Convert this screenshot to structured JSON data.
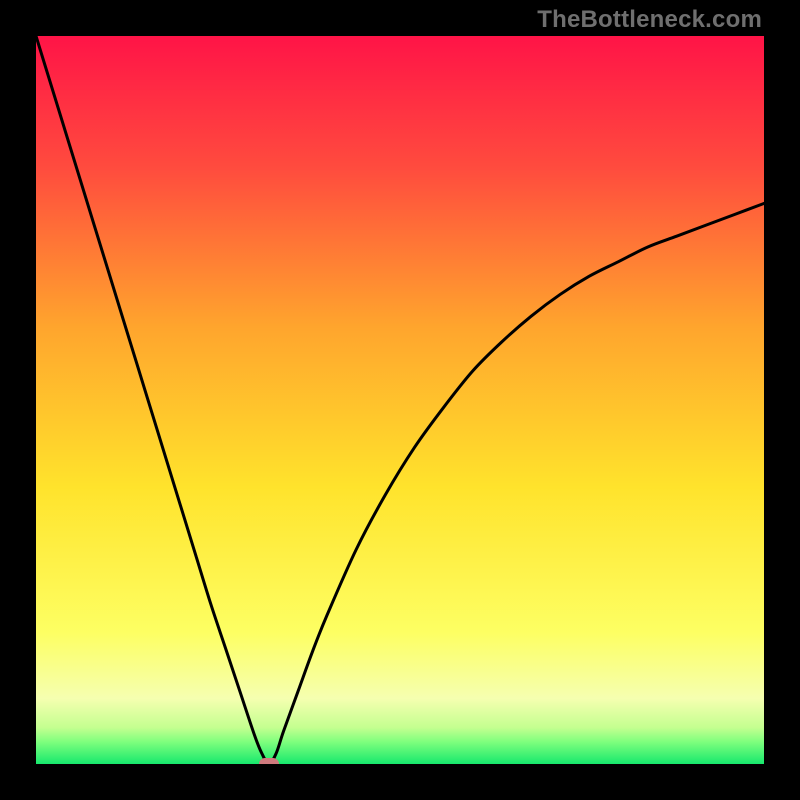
{
  "attribution": "TheBottleneck.com",
  "chart_data": {
    "type": "line",
    "title": "",
    "xlabel": "",
    "ylabel": "",
    "xlim": [
      0,
      100
    ],
    "ylim": [
      0,
      100
    ],
    "x_optimum": 32,
    "series": [
      {
        "name": "bottleneck-curve",
        "x": [
          0,
          2,
          4,
          6,
          8,
          10,
          12,
          14,
          16,
          18,
          20,
          22,
          24,
          26,
          28,
          30,
          31,
          32,
          33,
          34,
          36,
          38,
          40,
          44,
          48,
          52,
          56,
          60,
          64,
          68,
          72,
          76,
          80,
          84,
          88,
          92,
          96,
          100
        ],
        "values": [
          100,
          93.5,
          87,
          80.5,
          74,
          67.5,
          61,
          54.5,
          48,
          41.5,
          35,
          28.5,
          22,
          16,
          10,
          4,
          1.5,
          0,
          1.5,
          4.5,
          10,
          15.5,
          20.5,
          29.5,
          37,
          43.5,
          49,
          54,
          58,
          61.5,
          64.5,
          67,
          69,
          71,
          72.5,
          74,
          75.5,
          77
        ]
      }
    ],
    "gradient_stops": [
      {
        "pct": 0,
        "color": "#ff1447"
      },
      {
        "pct": 18,
        "color": "#ff4b3e"
      },
      {
        "pct": 40,
        "color": "#ffa52d"
      },
      {
        "pct": 62,
        "color": "#ffe32c"
      },
      {
        "pct": 82,
        "color": "#fdff63"
      },
      {
        "pct": 91,
        "color": "#f5ffb0"
      },
      {
        "pct": 95,
        "color": "#c4ff90"
      },
      {
        "pct": 97,
        "color": "#7dff7d"
      },
      {
        "pct": 100,
        "color": "#17e86d"
      }
    ],
    "marker": {
      "x": 32,
      "y": 0,
      "color": "#cf7a7d"
    }
  }
}
